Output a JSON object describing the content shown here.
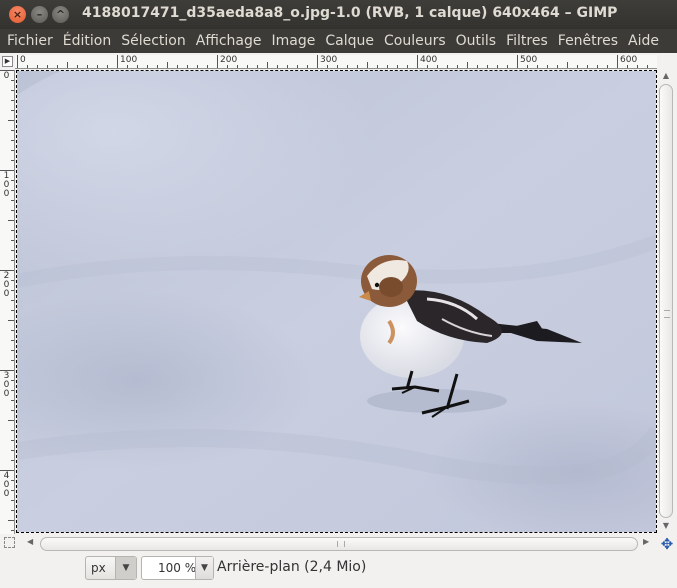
{
  "window": {
    "title": "4188017471_d35aeda8a8_o.jpg-1.0 (RVB, 1 calque) 640x464 – GIMP",
    "close_glyph": "×",
    "minimize_glyph": "–",
    "maximize_glyph": "^"
  },
  "menubar": {
    "items": [
      "Fichier",
      "Édition",
      "Sélection",
      "Affichage",
      "Image",
      "Calque",
      "Couleurs",
      "Outils",
      "Filtres",
      "Fenêtres",
      "Aide"
    ]
  },
  "rulers": {
    "horizontal_labels": [
      "0",
      "100",
      "200",
      "300",
      "400",
      "500",
      "600"
    ],
    "vertical_labels": [
      "0",
      "100",
      "200",
      "300",
      "400"
    ]
  },
  "statusbar": {
    "unit": "px",
    "zoom": "100 %",
    "layer_info": "Arrière-plan (2,4 Mio)"
  },
  "colors": {
    "titlebar": "#3c3b37",
    "close_button": "#e95420",
    "snow": "#c9cfe0",
    "nav_icon": "#2a5db0"
  },
  "icons": {
    "canvas_menu": "triangle-right-icon",
    "quick_mask": "quick-mask-icon",
    "navigate": "navigate-icon"
  }
}
